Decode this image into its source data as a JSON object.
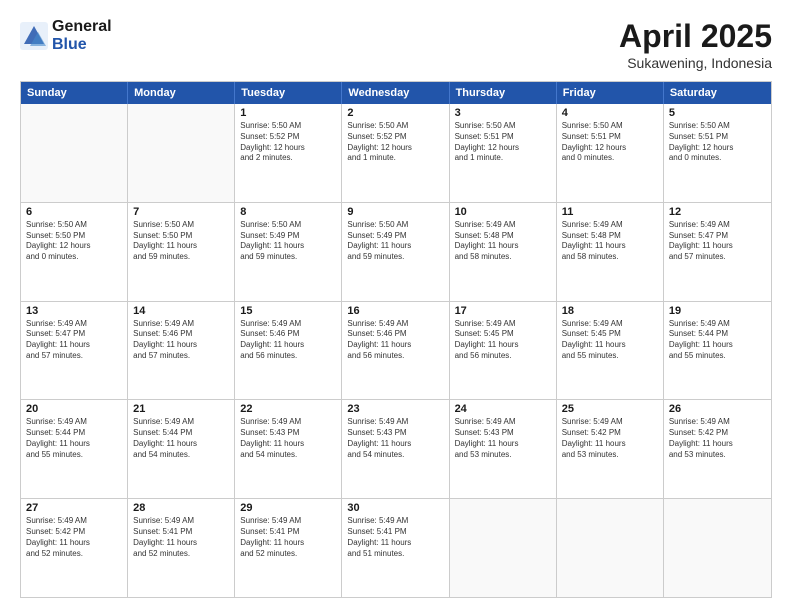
{
  "logo": {
    "general": "General",
    "blue": "Blue"
  },
  "title": "April 2025",
  "subtitle": "Sukawening, Indonesia",
  "header_days": [
    "Sunday",
    "Monday",
    "Tuesday",
    "Wednesday",
    "Thursday",
    "Friday",
    "Saturday"
  ],
  "rows": [
    [
      {
        "day": "",
        "lines": []
      },
      {
        "day": "",
        "lines": []
      },
      {
        "day": "1",
        "lines": [
          "Sunrise: 5:50 AM",
          "Sunset: 5:52 PM",
          "Daylight: 12 hours",
          "and 2 minutes."
        ]
      },
      {
        "day": "2",
        "lines": [
          "Sunrise: 5:50 AM",
          "Sunset: 5:52 PM",
          "Daylight: 12 hours",
          "and 1 minute."
        ]
      },
      {
        "day": "3",
        "lines": [
          "Sunrise: 5:50 AM",
          "Sunset: 5:51 PM",
          "Daylight: 12 hours",
          "and 1 minute."
        ]
      },
      {
        "day": "4",
        "lines": [
          "Sunrise: 5:50 AM",
          "Sunset: 5:51 PM",
          "Daylight: 12 hours",
          "and 0 minutes."
        ]
      },
      {
        "day": "5",
        "lines": [
          "Sunrise: 5:50 AM",
          "Sunset: 5:51 PM",
          "Daylight: 12 hours",
          "and 0 minutes."
        ]
      }
    ],
    [
      {
        "day": "6",
        "lines": [
          "Sunrise: 5:50 AM",
          "Sunset: 5:50 PM",
          "Daylight: 12 hours",
          "and 0 minutes."
        ]
      },
      {
        "day": "7",
        "lines": [
          "Sunrise: 5:50 AM",
          "Sunset: 5:50 PM",
          "Daylight: 11 hours",
          "and 59 minutes."
        ]
      },
      {
        "day": "8",
        "lines": [
          "Sunrise: 5:50 AM",
          "Sunset: 5:49 PM",
          "Daylight: 11 hours",
          "and 59 minutes."
        ]
      },
      {
        "day": "9",
        "lines": [
          "Sunrise: 5:50 AM",
          "Sunset: 5:49 PM",
          "Daylight: 11 hours",
          "and 59 minutes."
        ]
      },
      {
        "day": "10",
        "lines": [
          "Sunrise: 5:49 AM",
          "Sunset: 5:48 PM",
          "Daylight: 11 hours",
          "and 58 minutes."
        ]
      },
      {
        "day": "11",
        "lines": [
          "Sunrise: 5:49 AM",
          "Sunset: 5:48 PM",
          "Daylight: 11 hours",
          "and 58 minutes."
        ]
      },
      {
        "day": "12",
        "lines": [
          "Sunrise: 5:49 AM",
          "Sunset: 5:47 PM",
          "Daylight: 11 hours",
          "and 57 minutes."
        ]
      }
    ],
    [
      {
        "day": "13",
        "lines": [
          "Sunrise: 5:49 AM",
          "Sunset: 5:47 PM",
          "Daylight: 11 hours",
          "and 57 minutes."
        ]
      },
      {
        "day": "14",
        "lines": [
          "Sunrise: 5:49 AM",
          "Sunset: 5:46 PM",
          "Daylight: 11 hours",
          "and 57 minutes."
        ]
      },
      {
        "day": "15",
        "lines": [
          "Sunrise: 5:49 AM",
          "Sunset: 5:46 PM",
          "Daylight: 11 hours",
          "and 56 minutes."
        ]
      },
      {
        "day": "16",
        "lines": [
          "Sunrise: 5:49 AM",
          "Sunset: 5:46 PM",
          "Daylight: 11 hours",
          "and 56 minutes."
        ]
      },
      {
        "day": "17",
        "lines": [
          "Sunrise: 5:49 AM",
          "Sunset: 5:45 PM",
          "Daylight: 11 hours",
          "and 56 minutes."
        ]
      },
      {
        "day": "18",
        "lines": [
          "Sunrise: 5:49 AM",
          "Sunset: 5:45 PM",
          "Daylight: 11 hours",
          "and 55 minutes."
        ]
      },
      {
        "day": "19",
        "lines": [
          "Sunrise: 5:49 AM",
          "Sunset: 5:44 PM",
          "Daylight: 11 hours",
          "and 55 minutes."
        ]
      }
    ],
    [
      {
        "day": "20",
        "lines": [
          "Sunrise: 5:49 AM",
          "Sunset: 5:44 PM",
          "Daylight: 11 hours",
          "and 55 minutes."
        ]
      },
      {
        "day": "21",
        "lines": [
          "Sunrise: 5:49 AM",
          "Sunset: 5:44 PM",
          "Daylight: 11 hours",
          "and 54 minutes."
        ]
      },
      {
        "day": "22",
        "lines": [
          "Sunrise: 5:49 AM",
          "Sunset: 5:43 PM",
          "Daylight: 11 hours",
          "and 54 minutes."
        ]
      },
      {
        "day": "23",
        "lines": [
          "Sunrise: 5:49 AM",
          "Sunset: 5:43 PM",
          "Daylight: 11 hours",
          "and 54 minutes."
        ]
      },
      {
        "day": "24",
        "lines": [
          "Sunrise: 5:49 AM",
          "Sunset: 5:43 PM",
          "Daylight: 11 hours",
          "and 53 minutes."
        ]
      },
      {
        "day": "25",
        "lines": [
          "Sunrise: 5:49 AM",
          "Sunset: 5:42 PM",
          "Daylight: 11 hours",
          "and 53 minutes."
        ]
      },
      {
        "day": "26",
        "lines": [
          "Sunrise: 5:49 AM",
          "Sunset: 5:42 PM",
          "Daylight: 11 hours",
          "and 53 minutes."
        ]
      }
    ],
    [
      {
        "day": "27",
        "lines": [
          "Sunrise: 5:49 AM",
          "Sunset: 5:42 PM",
          "Daylight: 11 hours",
          "and 52 minutes."
        ]
      },
      {
        "day": "28",
        "lines": [
          "Sunrise: 5:49 AM",
          "Sunset: 5:41 PM",
          "Daylight: 11 hours",
          "and 52 minutes."
        ]
      },
      {
        "day": "29",
        "lines": [
          "Sunrise: 5:49 AM",
          "Sunset: 5:41 PM",
          "Daylight: 11 hours",
          "and 52 minutes."
        ]
      },
      {
        "day": "30",
        "lines": [
          "Sunrise: 5:49 AM",
          "Sunset: 5:41 PM",
          "Daylight: 11 hours",
          "and 51 minutes."
        ]
      },
      {
        "day": "",
        "lines": []
      },
      {
        "day": "",
        "lines": []
      },
      {
        "day": "",
        "lines": []
      }
    ]
  ]
}
